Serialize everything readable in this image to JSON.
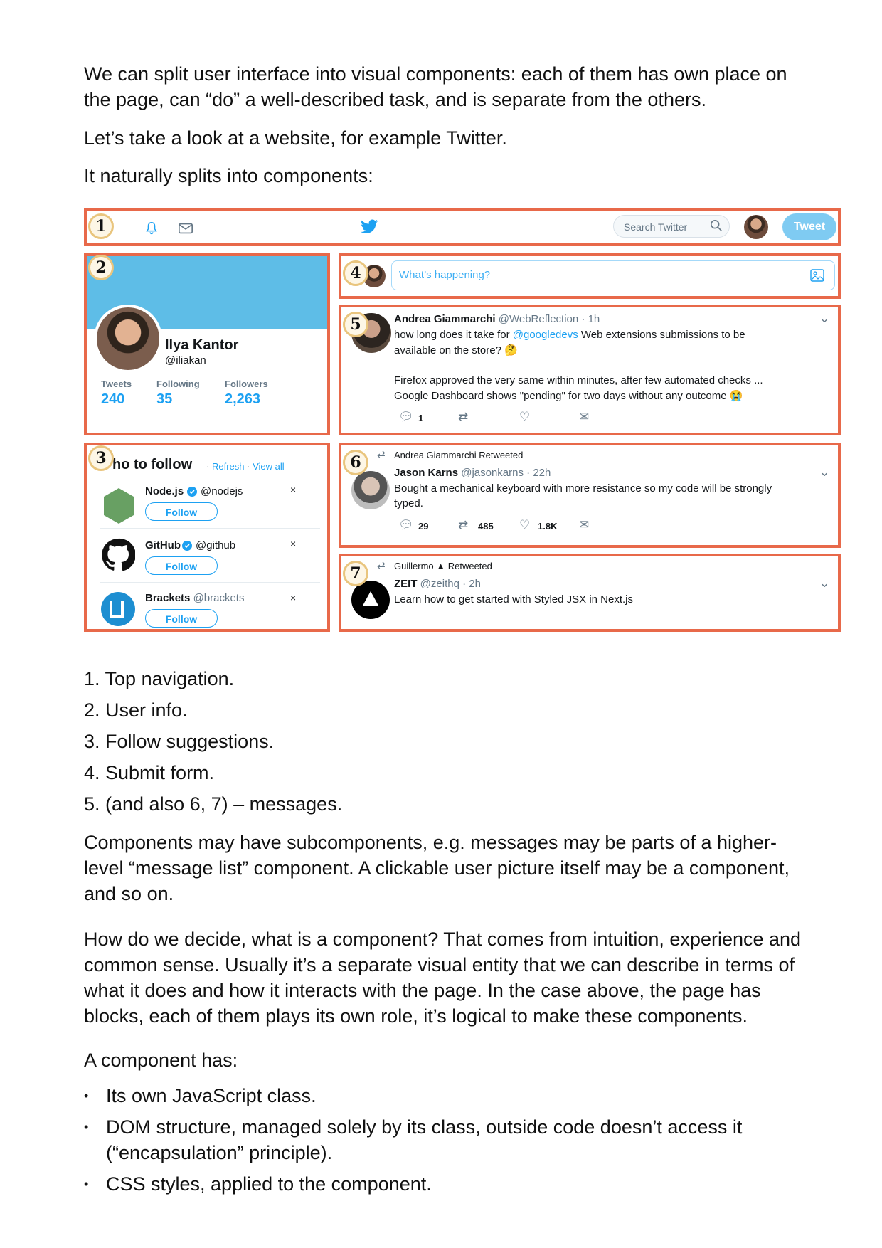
{
  "intro": {
    "p1": "We can split user interface into visual components: each of them has own place on the page, can “do” a well-described task, and is separate from the others.",
    "p2": "Let’s take a look at a website, for example Twitter.",
    "p3": "It naturally splits into components:"
  },
  "figure": {
    "numbers": [
      "1",
      "2",
      "3",
      "4",
      "5",
      "6",
      "7"
    ],
    "nav": {
      "search_placeholder": "Search Twitter",
      "tweet_button": "Tweet"
    },
    "profile": {
      "name": "Ilya Kantor",
      "handle": "@iliakan",
      "stats": [
        {
          "label": "Tweets",
          "value": "240"
        },
        {
          "label": "Following",
          "value": "35"
        },
        {
          "label": "Followers",
          "value": "2,263"
        }
      ]
    },
    "who_to_follow": {
      "title": "ho to follow",
      "refresh": "Refresh",
      "sep": "·",
      "view_all": "View all",
      "accounts": [
        {
          "name": "Node.js",
          "handle": "@nodejs",
          "button": "Follow"
        },
        {
          "name": "GitHub",
          "handle": "@github",
          "button": "Follow"
        },
        {
          "name": "Brackets",
          "handle": "@brackets",
          "button": "Follow"
        }
      ]
    },
    "compose": {
      "placeholder": "What’s happening?"
    },
    "tweet5": {
      "name": "Andrea Giammarchi",
      "handle": "@WebReflection · 1h",
      "line1_pre": "how long does it take for ",
      "line1_link": "@googledevs",
      "line1_post": " Web extensions submissions to be",
      "line2": "available on the store? 🤔",
      "line3": "Firefox approved the very same within minutes, after few automated checks ...",
      "line4": "Google Dashboard shows \"pending\" for two days without any outcome 😭",
      "replies": "1"
    },
    "tweet6": {
      "retweeted_by": "Andrea Giammarchi Retweeted",
      "name": "Jason Karns",
      "handle": "@jasonkarns · 22h",
      "line1": "Bought a mechanical keyboard with more resistance so my code will be strongly",
      "line2": "typed.",
      "replies": "29",
      "retweets": "485",
      "likes": "1.8K"
    },
    "tweet7": {
      "retweeted_by": "Guillermo ▲ Retweeted",
      "name": "ZEIT",
      "handle": "@zeithq · 2h",
      "line1": "Learn how to get started with Styled JSX in Next.js"
    }
  },
  "list": [
    "1. Top navigation.",
    "2. User info.",
    "3. Follow suggestions.",
    "4. Submit form.",
    "5. (and also 6, 7) – messages."
  ],
  "paragraphs": {
    "p4": "Components may have subcomponents, e.g. messages may be parts of a higher-level “message list” component. A clickable user picture itself may be a component, and so on.",
    "p5": "How do we decide, what is a component? That comes from intuition, experience and common sense. Usually it’s a separate visual entity that we can describe in terms of what it does and how it interacts with the page. In the case above, the page has blocks, each of them plays its own role, it’s logical to make these components.",
    "p6": "A component has:"
  },
  "bullets": [
    "Its own JavaScript class.",
    "DOM structure, managed solely by its class, outside code doesn’t access it (“encapsulation” principle).",
    "CSS styles, applied to the component."
  ],
  "colors": {
    "highlight_border": "#e8694a",
    "twitter_blue": "#1da1f2",
    "banner": "#5ebde7"
  }
}
